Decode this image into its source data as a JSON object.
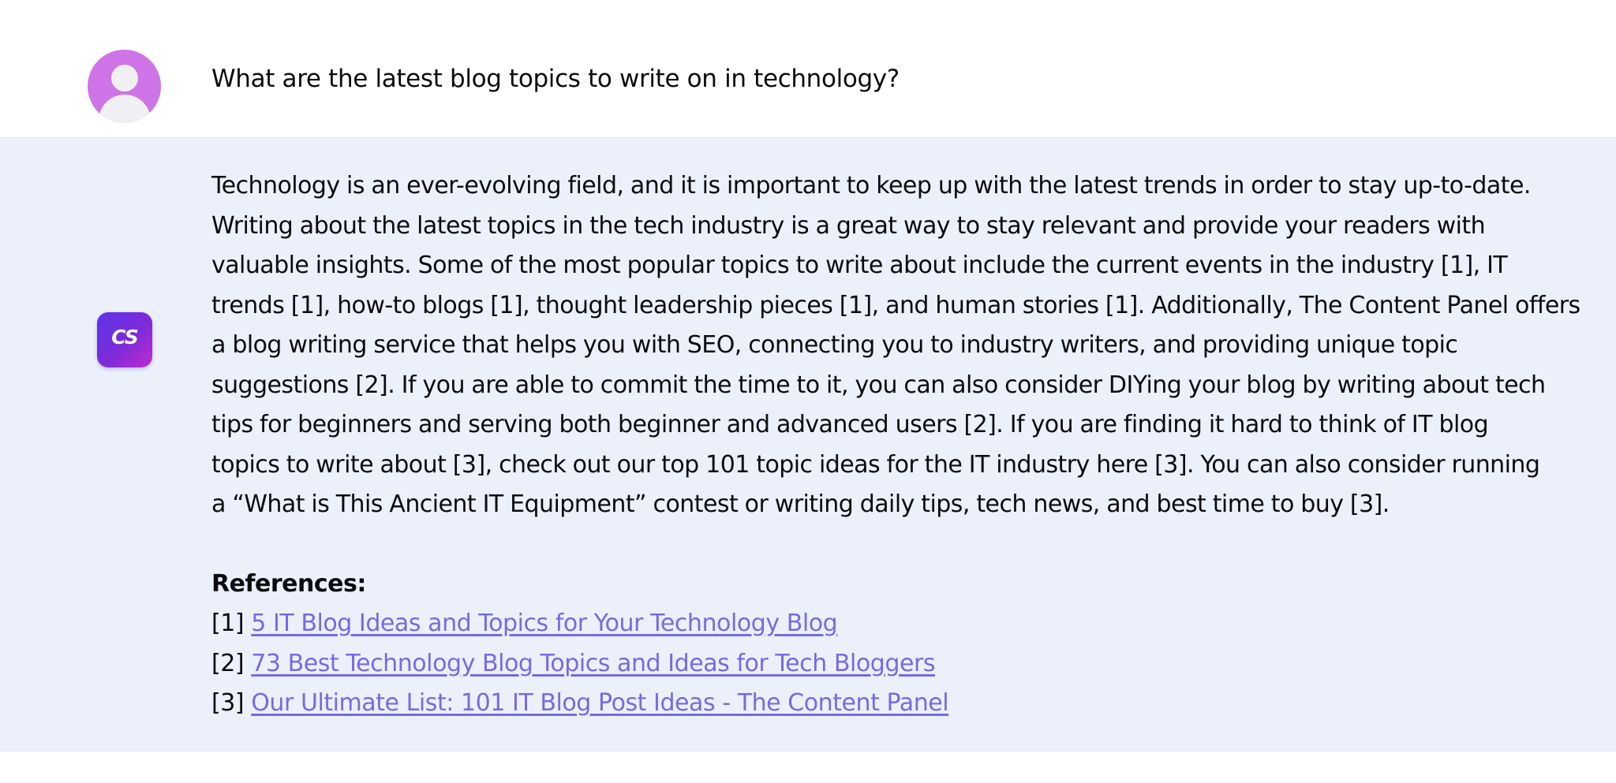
{
  "user_message": {
    "avatar_icon": "user-icon",
    "avatar_color": "#cf74e7",
    "text": "What are the latest blog topics to write on in technology?"
  },
  "bot_message": {
    "avatar_label": "CS",
    "answer_lines": [
      "Technology is an ever-evolving field, and it is important to keep up with the latest trends in order to stay up-to-date.",
      "Writing about the latest topics in the tech industry is a great way to stay relevant and provide your readers with",
      "valuable insights. Some of the most popular topics to write about include the current events in the industry [1], IT",
      "trends [1], how-to blogs [1], thought leadership pieces [1], and human stories [1]. Additionally, The Content Panel offers",
      "a blog writing service that helps you with SEO, connecting you to industry writers, and providing unique topic",
      "suggestions [2]. If you are able to commit the time to it, you can also consider DIYing your blog by writing about tech",
      "tips for beginners and serving both beginner and advanced users [2]. If you are finding it hard to think of IT blog",
      "topics to write about [3], check out our top 101 topic ideas for the IT industry here [3]. You can also consider running",
      "a “What is This Ancient IT Equipment” contest or writing daily tips, tech news, and best time to buy [3]."
    ],
    "references_title": "References:",
    "references": [
      {
        "marker": "[1]",
        "title": "5 IT Blog Ideas and Topics for Your Technology Blog"
      },
      {
        "marker": "[2]",
        "title": "73 Best Technology Blog Topics and Ideas for Tech Bloggers"
      },
      {
        "marker": "[3]",
        "title": "Our Ultimate List: 101 IT Blog Post Ideas - The Content Panel"
      }
    ]
  },
  "colors": {
    "bot_background": "#ecf0fb",
    "link": "#7a68e6",
    "avatar_gradient_start": "#5b35e8",
    "avatar_gradient_end": "#c02bd0"
  }
}
